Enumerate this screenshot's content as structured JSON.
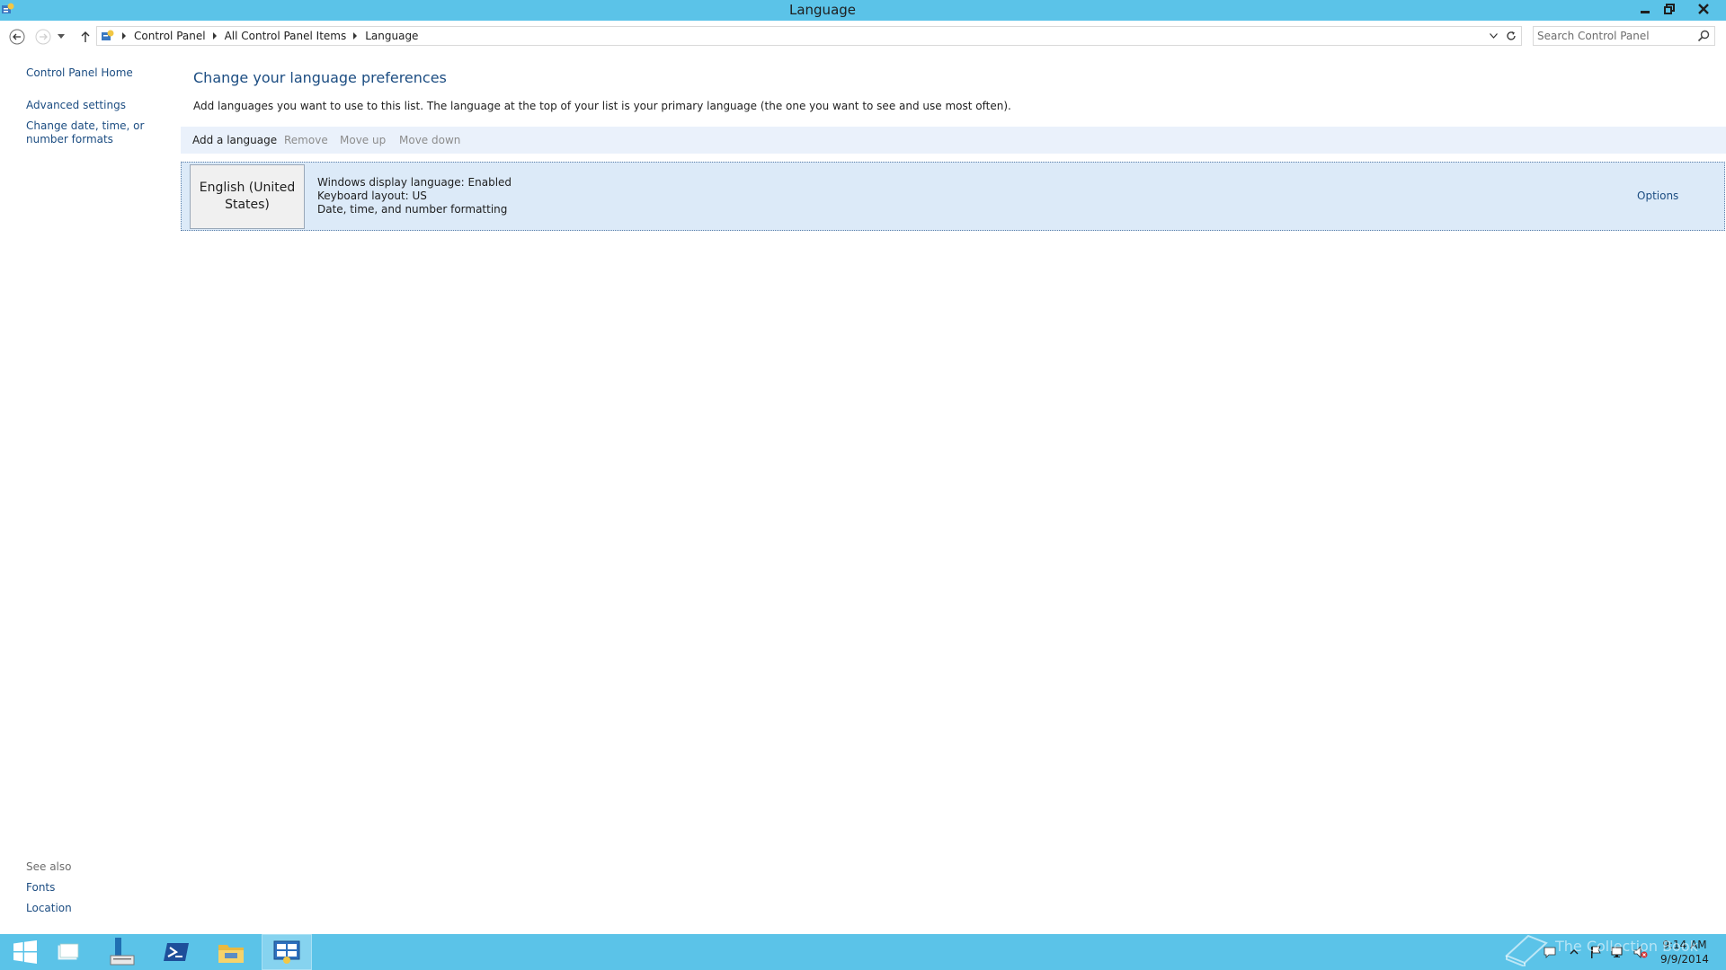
{
  "window": {
    "title": "Language"
  },
  "address": {
    "crumbs": [
      "Control Panel",
      "All Control Panel Items",
      "Language"
    ]
  },
  "search": {
    "placeholder": "Search Control Panel"
  },
  "sidebar": {
    "links": [
      "Control Panel Home",
      "Advanced settings",
      "Change date, time, or number formats"
    ],
    "see_also_heading": "See also",
    "see_also_links": [
      "Fonts",
      "Location"
    ]
  },
  "main": {
    "title": "Change your language preferences",
    "description": "Add languages you want to use to this list. The language at the top of your list is your primary language (the one you want to see and use most often).",
    "toolbar": {
      "add": "Add a language",
      "remove": "Remove",
      "move_up": "Move up",
      "move_down": "Move down"
    },
    "languages": [
      {
        "name": "English (United States)",
        "details": [
          "Windows display language: Enabled",
          "Keyboard layout: US",
          "Date, time, and number formatting"
        ],
        "options_label": "Options"
      }
    ]
  },
  "taskbar": {
    "clock_time": "9:14 AM",
    "clock_date": "9/9/2014",
    "watermark": "The Collection Book"
  },
  "colors": {
    "titlebar": "#5bc3e8",
    "link": "#1c4d82",
    "toolbar_bg": "#eaf1fb",
    "selected_row": "#dceaf8"
  }
}
